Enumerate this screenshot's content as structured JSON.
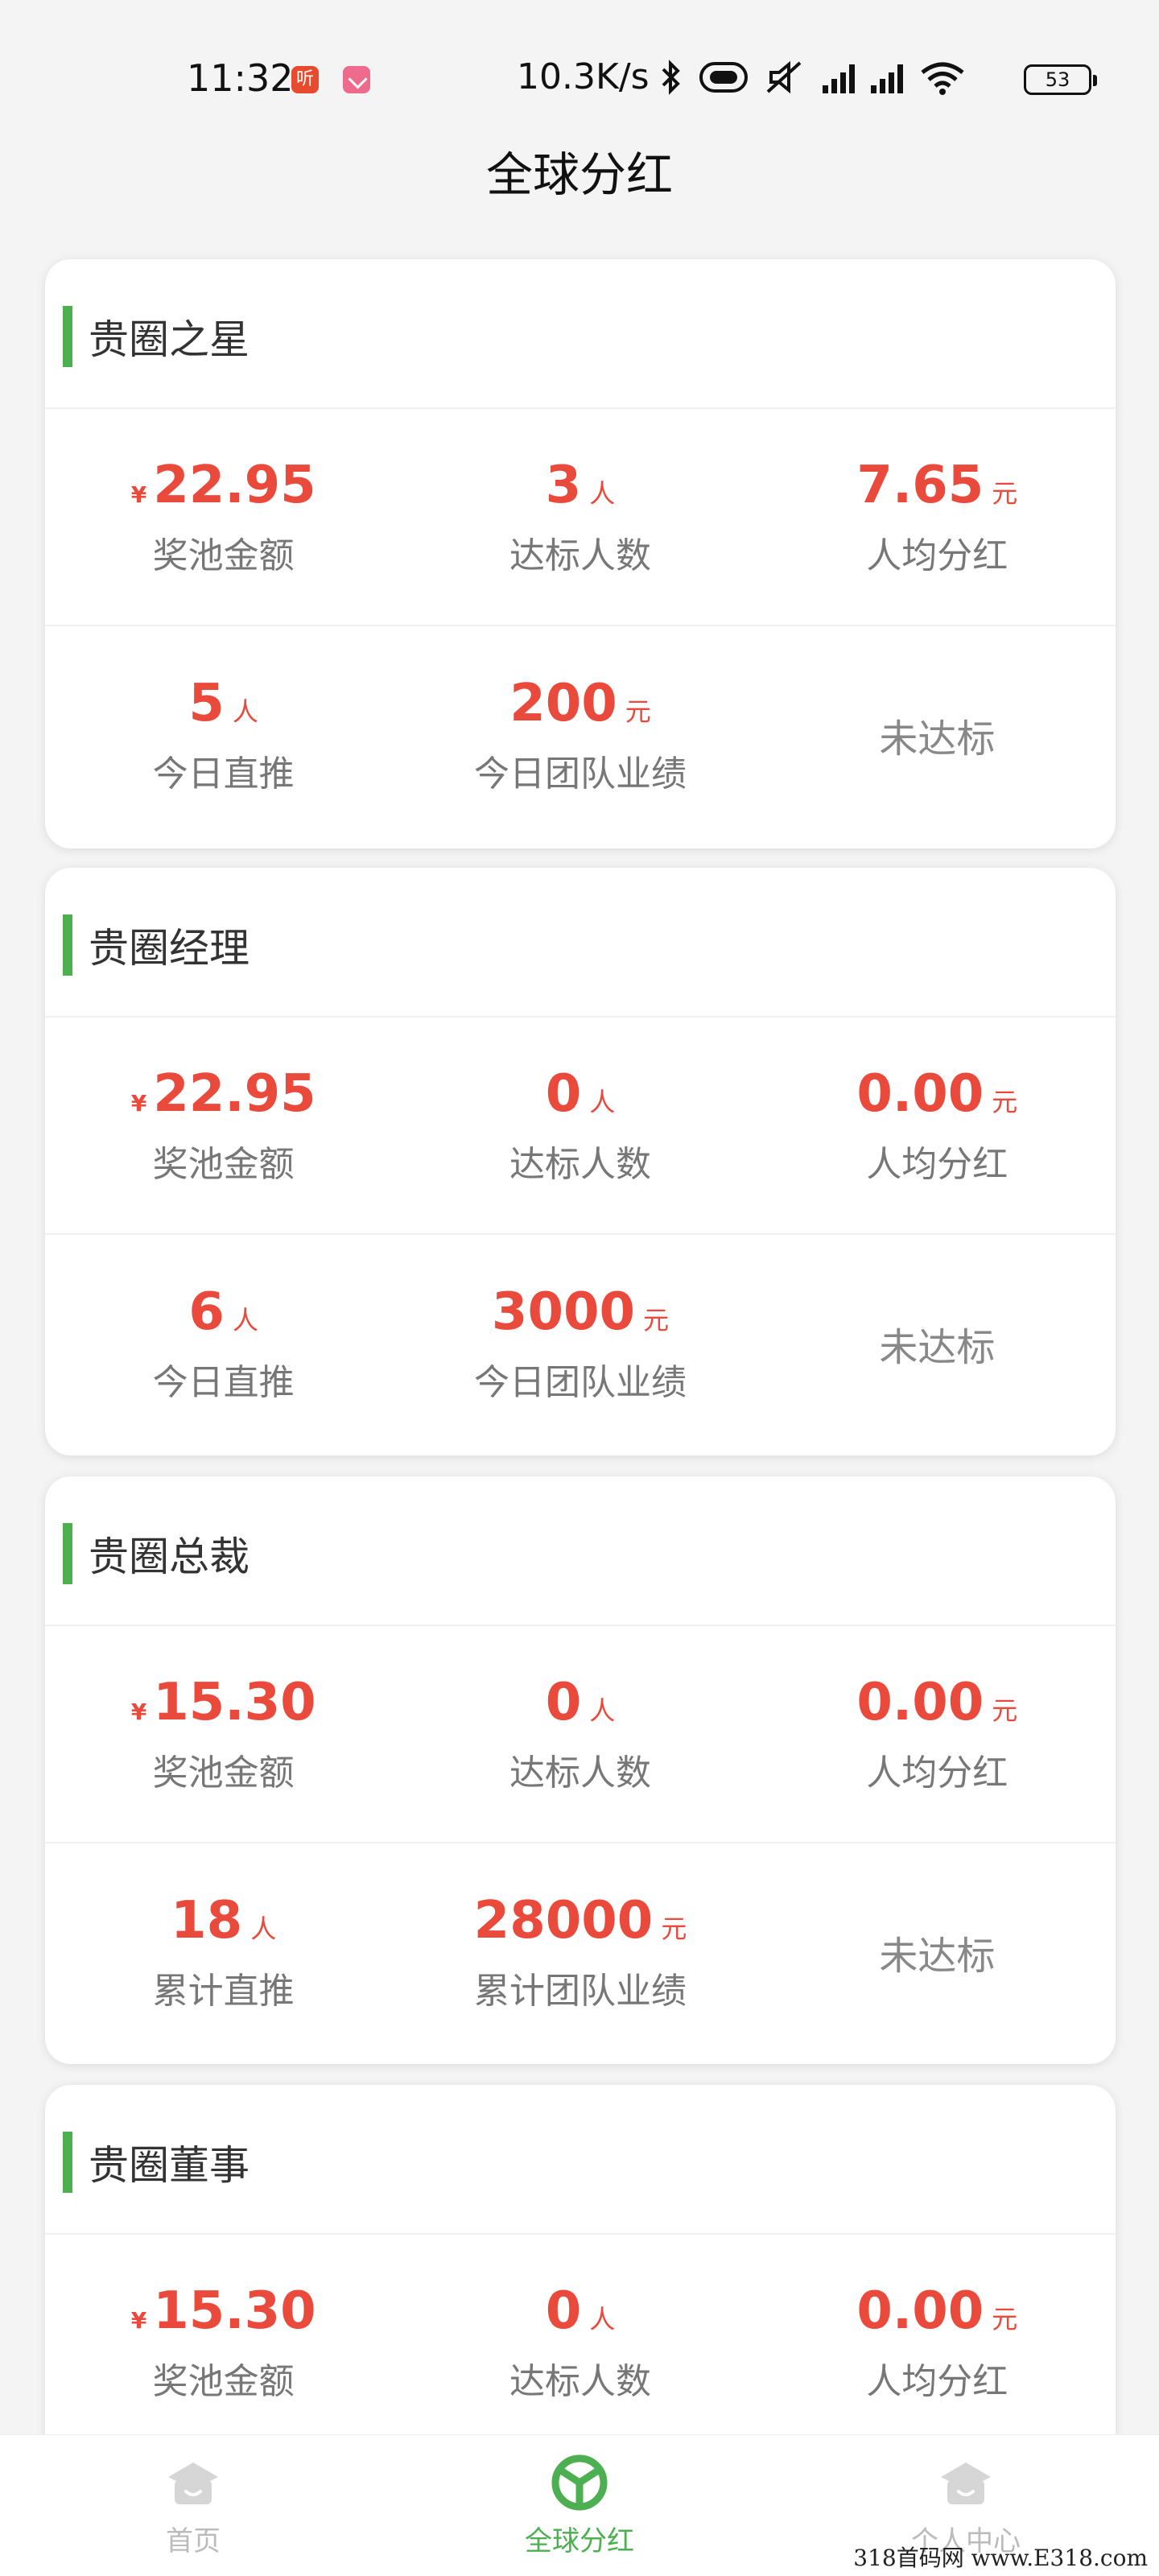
{
  "status_bar": {
    "time": "11:32",
    "app_badge": "听",
    "net_speed": "10.3K/s",
    "battery": "53"
  },
  "header": {
    "title": "全球分红"
  },
  "cards": [
    {
      "title": "贵圈之星",
      "stats": [
        {
          "prefix": "¥",
          "value": "22.95",
          "unit": "",
          "label": "奖池金额"
        },
        {
          "prefix": "",
          "value": "3",
          "unit": "人",
          "label": "达标人数"
        },
        {
          "prefix": "",
          "value": "7.65",
          "unit": "元",
          "label": "人均分红"
        }
      ],
      "progress": [
        {
          "value": "5",
          "unit": "人",
          "label": "今日直推"
        },
        {
          "value": "200",
          "unit": "元",
          "label": "今日团队业绩"
        }
      ],
      "status": "未达标"
    },
    {
      "title": "贵圈经理",
      "stats": [
        {
          "prefix": "¥",
          "value": "22.95",
          "unit": "",
          "label": "奖池金额"
        },
        {
          "prefix": "",
          "value": "0",
          "unit": "人",
          "label": "达标人数"
        },
        {
          "prefix": "",
          "value": "0.00",
          "unit": "元",
          "label": "人均分红"
        }
      ],
      "progress": [
        {
          "value": "6",
          "unit": "人",
          "label": "今日直推"
        },
        {
          "value": "3000",
          "unit": "元",
          "label": "今日团队业绩"
        }
      ],
      "status": "未达标"
    },
    {
      "title": "贵圈总裁",
      "stats": [
        {
          "prefix": "¥",
          "value": "15.30",
          "unit": "",
          "label": "奖池金额"
        },
        {
          "prefix": "",
          "value": "0",
          "unit": "人",
          "label": "达标人数"
        },
        {
          "prefix": "",
          "value": "0.00",
          "unit": "元",
          "label": "人均分红"
        }
      ],
      "progress": [
        {
          "value": "18",
          "unit": "人",
          "label": "累计直推"
        },
        {
          "value": "28000",
          "unit": "元",
          "label": "累计团队业绩"
        }
      ],
      "status": "未达标"
    },
    {
      "title": "贵圈董事",
      "stats": [
        {
          "prefix": "¥",
          "value": "15.30",
          "unit": "",
          "label": "奖池金额"
        },
        {
          "prefix": "",
          "value": "0",
          "unit": "人",
          "label": "达标人数"
        },
        {
          "prefix": "",
          "value": "0.00",
          "unit": "元",
          "label": "人均分红"
        }
      ]
    }
  ],
  "bottom_nav": {
    "items": [
      {
        "label": "首页",
        "icon": "home-icon"
      },
      {
        "label": "全球分红",
        "icon": "dividend-icon"
      },
      {
        "label": "个人中心",
        "icon": "profile-icon"
      }
    ]
  },
  "watermark": "318首码网 www.E318.com",
  "colors": {
    "accent_green": "#4caf50",
    "value_red": "#ea4a3c"
  }
}
